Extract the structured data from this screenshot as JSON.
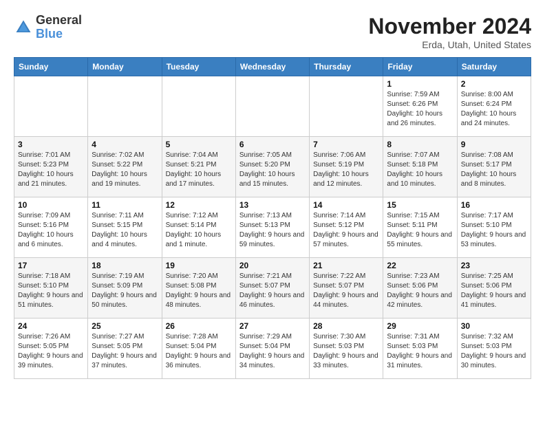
{
  "header": {
    "logo_general": "General",
    "logo_blue": "Blue",
    "month_title": "November 2024",
    "location": "Erda, Utah, United States"
  },
  "days_of_week": [
    "Sunday",
    "Monday",
    "Tuesday",
    "Wednesday",
    "Thursday",
    "Friday",
    "Saturday"
  ],
  "weeks": [
    [
      {
        "day": "",
        "info": ""
      },
      {
        "day": "",
        "info": ""
      },
      {
        "day": "",
        "info": ""
      },
      {
        "day": "",
        "info": ""
      },
      {
        "day": "",
        "info": ""
      },
      {
        "day": "1",
        "info": "Sunrise: 7:59 AM\nSunset: 6:26 PM\nDaylight: 10 hours and 26 minutes."
      },
      {
        "day": "2",
        "info": "Sunrise: 8:00 AM\nSunset: 6:24 PM\nDaylight: 10 hours and 24 minutes."
      }
    ],
    [
      {
        "day": "3",
        "info": "Sunrise: 7:01 AM\nSunset: 5:23 PM\nDaylight: 10 hours and 21 minutes."
      },
      {
        "day": "4",
        "info": "Sunrise: 7:02 AM\nSunset: 5:22 PM\nDaylight: 10 hours and 19 minutes."
      },
      {
        "day": "5",
        "info": "Sunrise: 7:04 AM\nSunset: 5:21 PM\nDaylight: 10 hours and 17 minutes."
      },
      {
        "day": "6",
        "info": "Sunrise: 7:05 AM\nSunset: 5:20 PM\nDaylight: 10 hours and 15 minutes."
      },
      {
        "day": "7",
        "info": "Sunrise: 7:06 AM\nSunset: 5:19 PM\nDaylight: 10 hours and 12 minutes."
      },
      {
        "day": "8",
        "info": "Sunrise: 7:07 AM\nSunset: 5:18 PM\nDaylight: 10 hours and 10 minutes."
      },
      {
        "day": "9",
        "info": "Sunrise: 7:08 AM\nSunset: 5:17 PM\nDaylight: 10 hours and 8 minutes."
      }
    ],
    [
      {
        "day": "10",
        "info": "Sunrise: 7:09 AM\nSunset: 5:16 PM\nDaylight: 10 hours and 6 minutes."
      },
      {
        "day": "11",
        "info": "Sunrise: 7:11 AM\nSunset: 5:15 PM\nDaylight: 10 hours and 4 minutes."
      },
      {
        "day": "12",
        "info": "Sunrise: 7:12 AM\nSunset: 5:14 PM\nDaylight: 10 hours and 1 minute."
      },
      {
        "day": "13",
        "info": "Sunrise: 7:13 AM\nSunset: 5:13 PM\nDaylight: 9 hours and 59 minutes."
      },
      {
        "day": "14",
        "info": "Sunrise: 7:14 AM\nSunset: 5:12 PM\nDaylight: 9 hours and 57 minutes."
      },
      {
        "day": "15",
        "info": "Sunrise: 7:15 AM\nSunset: 5:11 PM\nDaylight: 9 hours and 55 minutes."
      },
      {
        "day": "16",
        "info": "Sunrise: 7:17 AM\nSunset: 5:10 PM\nDaylight: 9 hours and 53 minutes."
      }
    ],
    [
      {
        "day": "17",
        "info": "Sunrise: 7:18 AM\nSunset: 5:10 PM\nDaylight: 9 hours and 51 minutes."
      },
      {
        "day": "18",
        "info": "Sunrise: 7:19 AM\nSunset: 5:09 PM\nDaylight: 9 hours and 50 minutes."
      },
      {
        "day": "19",
        "info": "Sunrise: 7:20 AM\nSunset: 5:08 PM\nDaylight: 9 hours and 48 minutes."
      },
      {
        "day": "20",
        "info": "Sunrise: 7:21 AM\nSunset: 5:07 PM\nDaylight: 9 hours and 46 minutes."
      },
      {
        "day": "21",
        "info": "Sunrise: 7:22 AM\nSunset: 5:07 PM\nDaylight: 9 hours and 44 minutes."
      },
      {
        "day": "22",
        "info": "Sunrise: 7:23 AM\nSunset: 5:06 PM\nDaylight: 9 hours and 42 minutes."
      },
      {
        "day": "23",
        "info": "Sunrise: 7:25 AM\nSunset: 5:06 PM\nDaylight: 9 hours and 41 minutes."
      }
    ],
    [
      {
        "day": "24",
        "info": "Sunrise: 7:26 AM\nSunset: 5:05 PM\nDaylight: 9 hours and 39 minutes."
      },
      {
        "day": "25",
        "info": "Sunrise: 7:27 AM\nSunset: 5:05 PM\nDaylight: 9 hours and 37 minutes."
      },
      {
        "day": "26",
        "info": "Sunrise: 7:28 AM\nSunset: 5:04 PM\nDaylight: 9 hours and 36 minutes."
      },
      {
        "day": "27",
        "info": "Sunrise: 7:29 AM\nSunset: 5:04 PM\nDaylight: 9 hours and 34 minutes."
      },
      {
        "day": "28",
        "info": "Sunrise: 7:30 AM\nSunset: 5:03 PM\nDaylight: 9 hours and 33 minutes."
      },
      {
        "day": "29",
        "info": "Sunrise: 7:31 AM\nSunset: 5:03 PM\nDaylight: 9 hours and 31 minutes."
      },
      {
        "day": "30",
        "info": "Sunrise: 7:32 AM\nSunset: 5:03 PM\nDaylight: 9 hours and 30 minutes."
      }
    ]
  ]
}
